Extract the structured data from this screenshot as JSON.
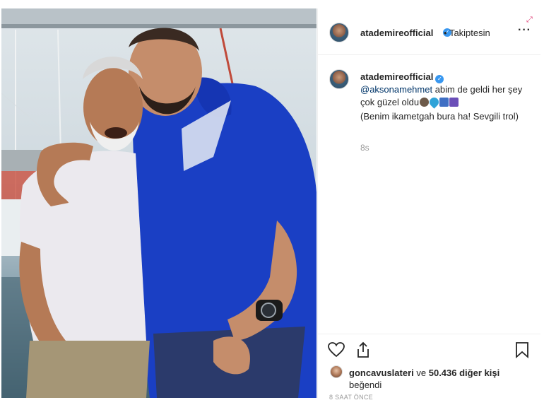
{
  "post": {
    "username": "atademireofficial",
    "follow_status": "Takiptesin",
    "more_icon": "more-dots-icon",
    "verified_icon": "verified-badge-icon",
    "expand_icon": "expand-icon"
  },
  "caption": {
    "username": "atademireofficial",
    "mention": "@aksonamehmet",
    "text_1": " abim de geldi her şey çok güzel oldu",
    "text_2": "(Benim ikametgah bura ha! Sevgili trol)",
    "emoji_names": [
      "anchor-emoji",
      "blue-heart-emoji",
      "ship-emoji",
      "swimmer-emoji"
    ],
    "time": "8s"
  },
  "actions": {
    "like_icon": "heart-icon",
    "share_icon": "share-icon",
    "save_icon": "bookmark-icon"
  },
  "likes": {
    "liker": "goncavuslateri",
    "connector": " ve ",
    "count": "50.436 diğer kişi",
    "suffix": "beğendi",
    "timeago": "8 SAAT ÖNCE"
  },
  "colors": {
    "verified": "#3897f0",
    "mention": "#003569",
    "muted": "#999999",
    "border": "#efefef"
  }
}
